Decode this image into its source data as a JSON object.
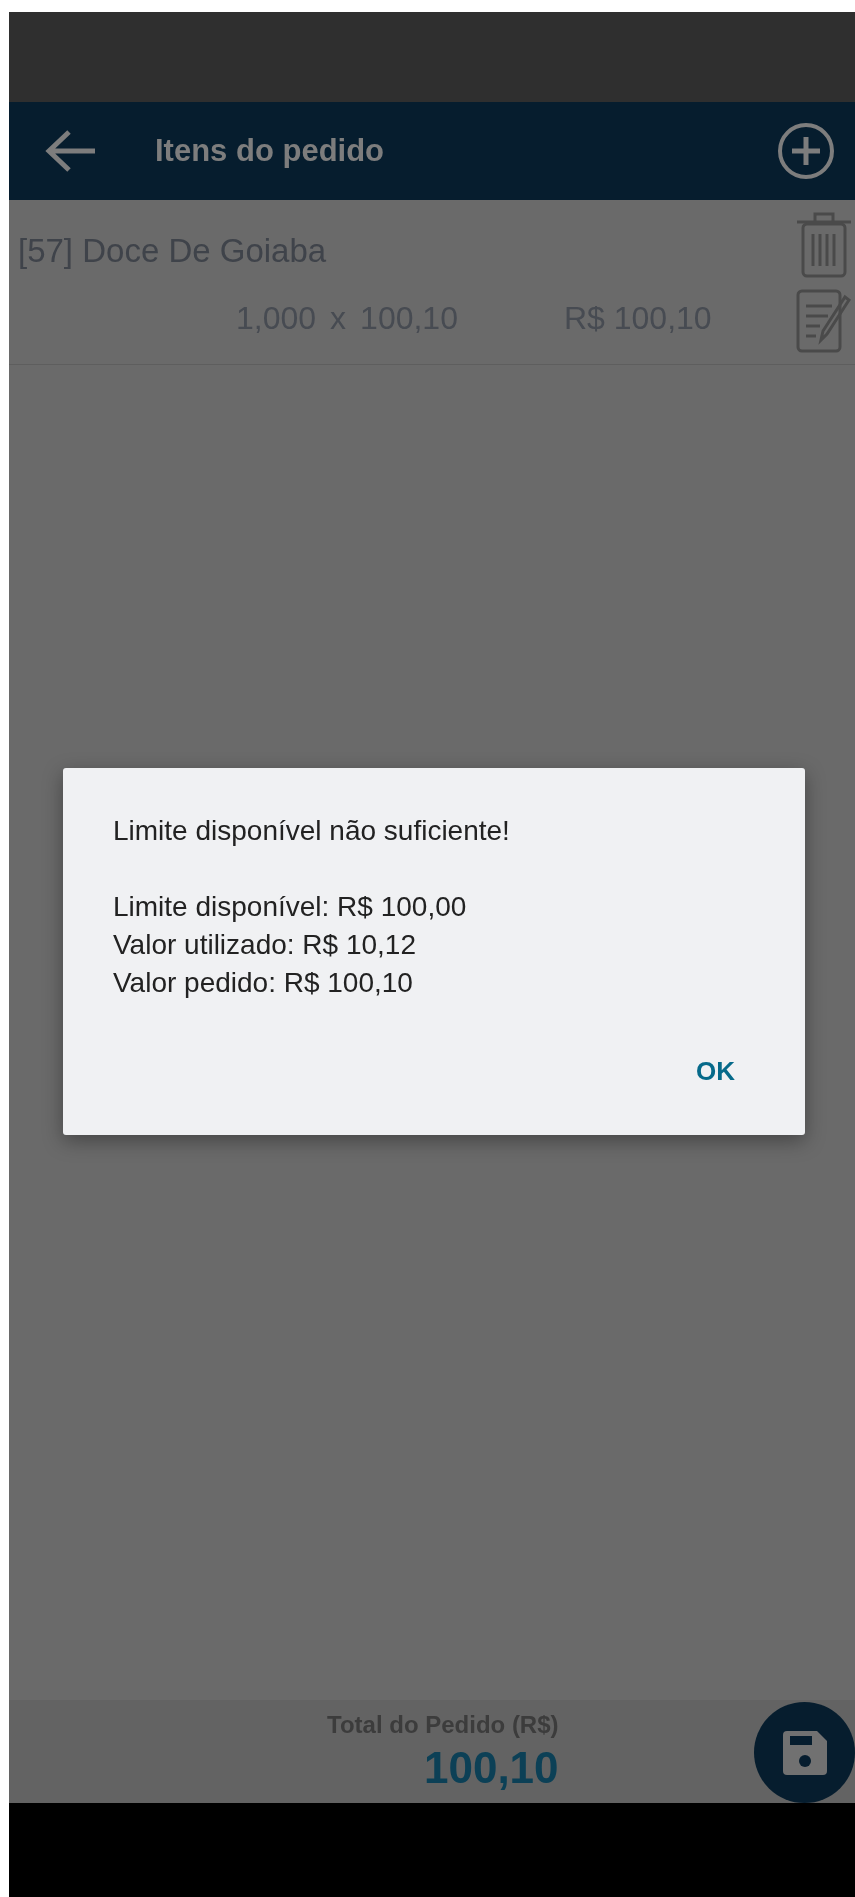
{
  "app_bar": {
    "title": "Itens do pedido"
  },
  "items": [
    {
      "name": "[57] Doce De Goiaba",
      "quantity": "1,000",
      "times": "x",
      "unit_price": "100,10",
      "total": "R$ 100,10"
    }
  ],
  "footer": {
    "label": "Total do Pedido (R$)",
    "total": "100,10"
  },
  "dialog": {
    "heading": "Limite disponível não suficiente!",
    "lines": [
      "Limite disponível: R$ 100,00",
      "Valor utilizado: R$ 10,12",
      "Valor pedido: R$ 100,10"
    ],
    "button": "OK"
  }
}
